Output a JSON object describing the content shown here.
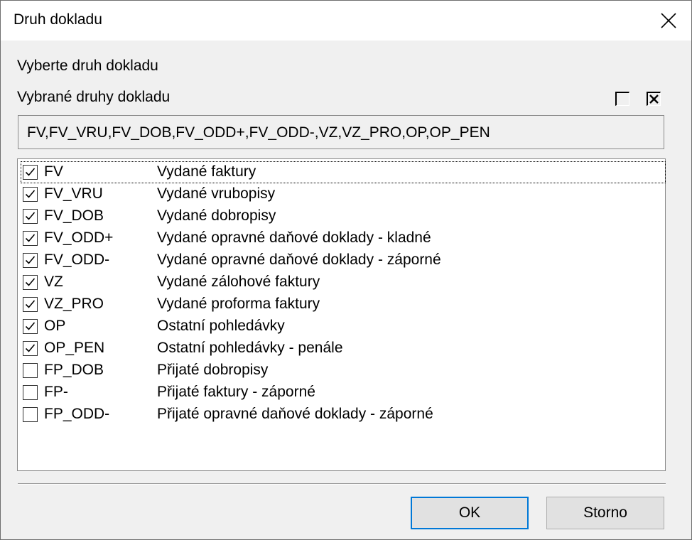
{
  "window": {
    "title": "Druh dokladu"
  },
  "prompt": "Vyberte druh dokladu",
  "selected_label": "Vybrané druhy dokladu",
  "selected_value": "FV,FV_VRU,FV_DOB,FV_ODD+,FV_ODD-,VZ,VZ_PRO,OP,OP_PEN",
  "items": [
    {
      "code": "FV",
      "desc": "Vydané faktury",
      "checked": true
    },
    {
      "code": "FV_VRU",
      "desc": "Vydané vrubopisy",
      "checked": true
    },
    {
      "code": "FV_DOB",
      "desc": "Vydané dobropisy",
      "checked": true
    },
    {
      "code": "FV_ODD+",
      "desc": "Vydané opravné daňové doklady - kladné",
      "checked": true
    },
    {
      "code": "FV_ODD-",
      "desc": "Vydané opravné daňové doklady - záporné",
      "checked": true
    },
    {
      "code": "VZ",
      "desc": "Vydané zálohové faktury",
      "checked": true
    },
    {
      "code": "VZ_PRO",
      "desc": "Vydané proforma faktury",
      "checked": true
    },
    {
      "code": "OP",
      "desc": "Ostatní pohledávky",
      "checked": true
    },
    {
      "code": "OP_PEN",
      "desc": "Ostatní pohledávky - penále",
      "checked": true
    },
    {
      "code": "FP_DOB",
      "desc": "Přijaté dobropisy",
      "checked": false
    },
    {
      "code": "FP-",
      "desc": "Přijaté faktury - záporné",
      "checked": false
    },
    {
      "code": "FP_ODD-",
      "desc": "Přijaté opravné daňové doklady - záporné",
      "checked": false
    }
  ],
  "buttons": {
    "ok": "OK",
    "cancel": "Storno"
  }
}
